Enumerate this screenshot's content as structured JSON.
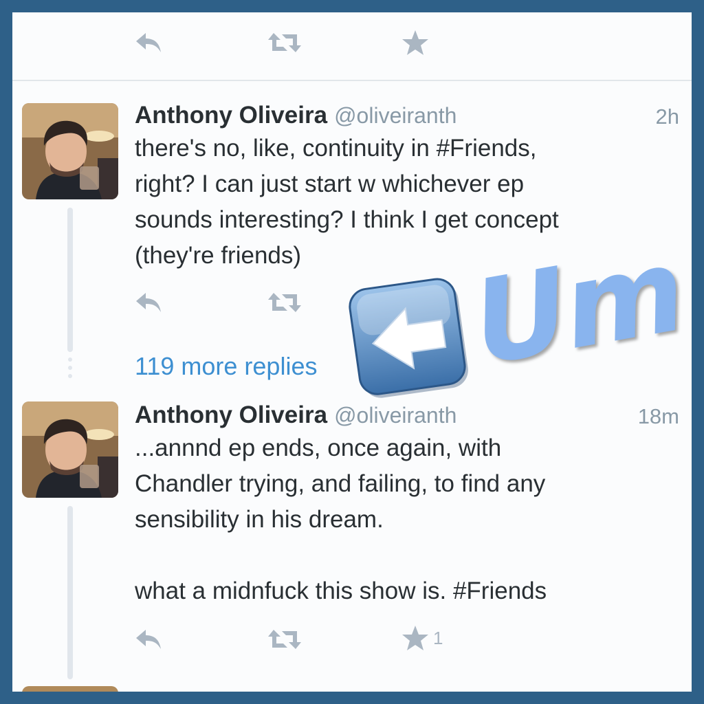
{
  "top_actions": {
    "reply": "reply-icon",
    "retweet": "retweet-icon",
    "favorite": "star-icon"
  },
  "tweets": [
    {
      "name": "Anthony Oliveira",
      "handle": "@oliveiranth",
      "time": "2h",
      "text": "there's no, like, continuity in #Friends,\nright? I can just start w whichever ep\nsounds interesting? I think I get concept\n(they're friends)"
    },
    {
      "name": "Anthony Oliveira",
      "handle": "@oliveiranth",
      "time": "18m",
      "text": "...annnd ep ends, once again, with\nChandler trying, and failing, to find any\nsensibility in his dream.\n\nwhat a midnfuck this show is. #Friends",
      "favorite_count": "1"
    }
  ],
  "more_replies": "119 more replies",
  "overlay": {
    "text": "Um.",
    "arrow_icon": "left-arrow-emoji-icon",
    "color": "#89b4ee"
  },
  "colors": {
    "frame": "#2e6088",
    "link": "#3d8fd1",
    "muted": "#8899a6"
  }
}
